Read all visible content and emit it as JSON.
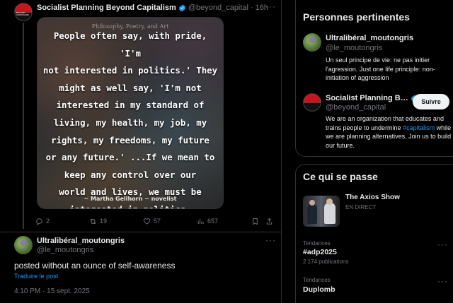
{
  "tweet1": {
    "author_name": "Socialist Planning Beyond Capitalism",
    "handle": "@beyond_capital",
    "separator": "·",
    "time": "16h",
    "avatar_text": "BEYOND CAPITALISM",
    "image": {
      "small_caption": "Philosophy, Poetry, and Art",
      "quote_lines": [
        "People often say, with pride, 'I'm",
        "not interested in politics.'  They",
        "might as well say, 'I'm not",
        "interested in my standard of",
        "living, my health, my job, my",
        "rights, my freedoms, my future",
        "or any future.' ...If we mean to",
        "keep any control over our",
        "world and lives, we must be",
        "interested in politics."
      ],
      "author": "~ Martha Gellhorn ~ novelist"
    },
    "actions": {
      "replies": "2",
      "retweets": "19",
      "likes": "57",
      "views": "657"
    }
  },
  "tweet2": {
    "author_name": "Ultralibéral_moutongris",
    "handle": "@le_moutongris",
    "text": "posted without an ounce of self-awareness",
    "translate": "Traduire le post",
    "timestamp": "4:10 PM · 15 sept. 2025"
  },
  "sidebar": {
    "relevant_title": "Personnes pertinentes",
    "people": [
      {
        "name": "Ultralibéral_moutongris",
        "handle": "@le_moutongris",
        "bio": "Un seul principe de vie: ne pas initier l'agression. Just one life principle: non-initiation of aggression"
      },
      {
        "name": "Socialist Planning B…",
        "handle": "@beyond_capital",
        "bio_before": "We are an organization that educates and trains people to undermine ",
        "bio_hashtag": "#capitalism",
        "bio_after": " while we are planning alternatives. Join us to build our future.",
        "follow_label": "Suivre"
      }
    ],
    "happening_title": "Ce qui se passe",
    "live": {
      "title": "The Axios Show",
      "status": "EN DIRECT"
    },
    "trends": [
      {
        "category": "Tendances",
        "name": "#adp2025",
        "count": "2 174 publications"
      },
      {
        "category": "Tendances",
        "name": "Duplomb",
        "count": ""
      }
    ]
  },
  "colors": {
    "background": "#000000",
    "link_blue": "#1d9bf0",
    "muted_text": "#71767b",
    "border": "#2f3336",
    "verified_blue": "#1d9bf0"
  },
  "icons": [
    "reply-icon",
    "retweet-icon",
    "like-icon",
    "views-icon",
    "bookmark-icon",
    "share-icon",
    "verified-icon",
    "more-icon"
  ]
}
